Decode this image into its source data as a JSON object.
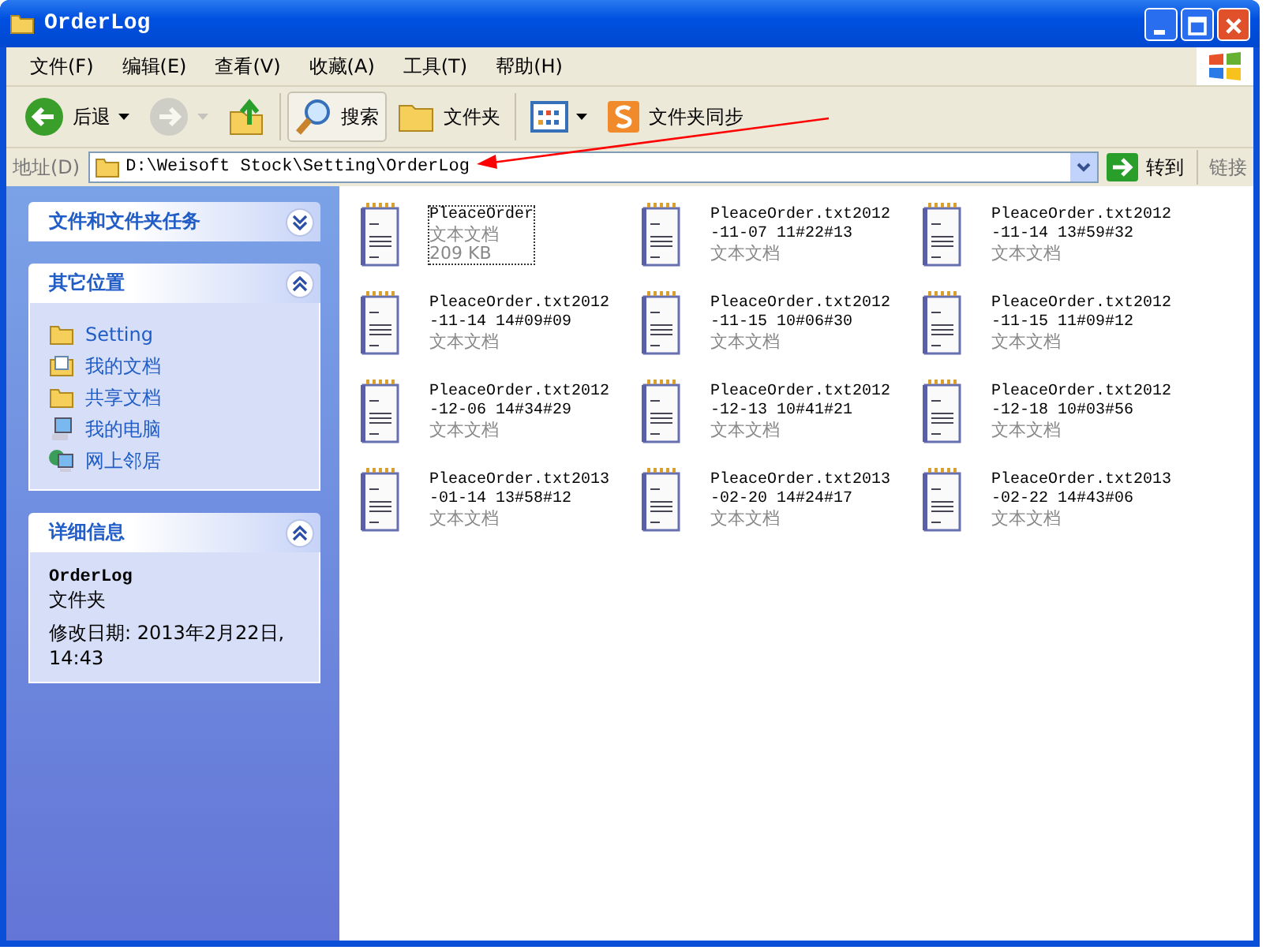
{
  "window": {
    "title": "OrderLog"
  },
  "menu": [
    "文件(F)",
    "编辑(E)",
    "查看(V)",
    "收藏(A)",
    "工具(T)",
    "帮助(H)"
  ],
  "toolbar": [
    {
      "kind": "back",
      "label": "后退",
      "disabled": false
    },
    {
      "kind": "forward",
      "disabled": true
    },
    {
      "kind": "up",
      "disabled": false
    },
    {
      "kind": "search",
      "label": "搜索",
      "disabled": false
    },
    {
      "kind": "folders",
      "label": "文件夹",
      "disabled": false
    },
    {
      "kind": "views",
      "disabled": false
    },
    {
      "kind": "sync",
      "label": "文件夹同步",
      "disabled": false
    }
  ],
  "address": {
    "label": "地址(D)",
    "value": "D:\\Weisoft Stock\\Setting\\OrderLog",
    "go": "转到",
    "links": "链接"
  },
  "sidebar": {
    "panels": [
      {
        "title": "文件和文件夹任务",
        "expanded": false
      },
      {
        "title": "其它位置",
        "expanded": true,
        "items": [
          {
            "label": "Setting",
            "kind": "folder"
          },
          {
            "label": "我的文档",
            "kind": "docs"
          },
          {
            "label": "共享文档",
            "kind": "folder"
          },
          {
            "label": "我的电脑",
            "kind": "computer"
          },
          {
            "label": "网上邻居",
            "kind": "network"
          }
        ]
      },
      {
        "title": "详细信息",
        "expanded": true,
        "details": {
          "name": "OrderLog",
          "type": "文件夹",
          "modified": "修改日期: 2013年2月22日, 14:43"
        }
      }
    ]
  },
  "files": [
    {
      "name": "PleaceOrder",
      "type": "文本文档",
      "size": "209 KB",
      "selected": true
    },
    {
      "name": "PleaceOrder.txt2012-11-07 11#22#13",
      "type": "文本文档",
      "selected": false
    },
    {
      "name": "PleaceOrder.txt2012-11-14 13#59#32",
      "type": "文本文档",
      "selected": false
    },
    {
      "name": "PleaceOrder.txt2012-11-14 14#09#09",
      "type": "文本文档",
      "selected": false
    },
    {
      "name": "PleaceOrder.txt2012-11-15 10#06#30",
      "type": "文本文档",
      "selected": false
    },
    {
      "name": "PleaceOrder.txt2012-11-15 11#09#12",
      "type": "文本文档",
      "selected": false
    },
    {
      "name": "PleaceOrder.txt2012-12-06 14#34#29",
      "type": "文本文档",
      "selected": false
    },
    {
      "name": "PleaceOrder.txt2012-12-13 10#41#21",
      "type": "文本文档",
      "selected": false
    },
    {
      "name": "PleaceOrder.txt2012-12-18 10#03#56",
      "type": "文本文档",
      "selected": false
    },
    {
      "name": "PleaceOrder.txt2013-01-14 13#58#12",
      "type": "文本文档",
      "selected": false
    },
    {
      "name": "PleaceOrder.txt2013-02-20 14#24#17",
      "type": "文本文档",
      "selected": false
    },
    {
      "name": "PleaceOrder.txt2013-02-22 14#43#06",
      "type": "文本文档",
      "selected": false
    }
  ]
}
